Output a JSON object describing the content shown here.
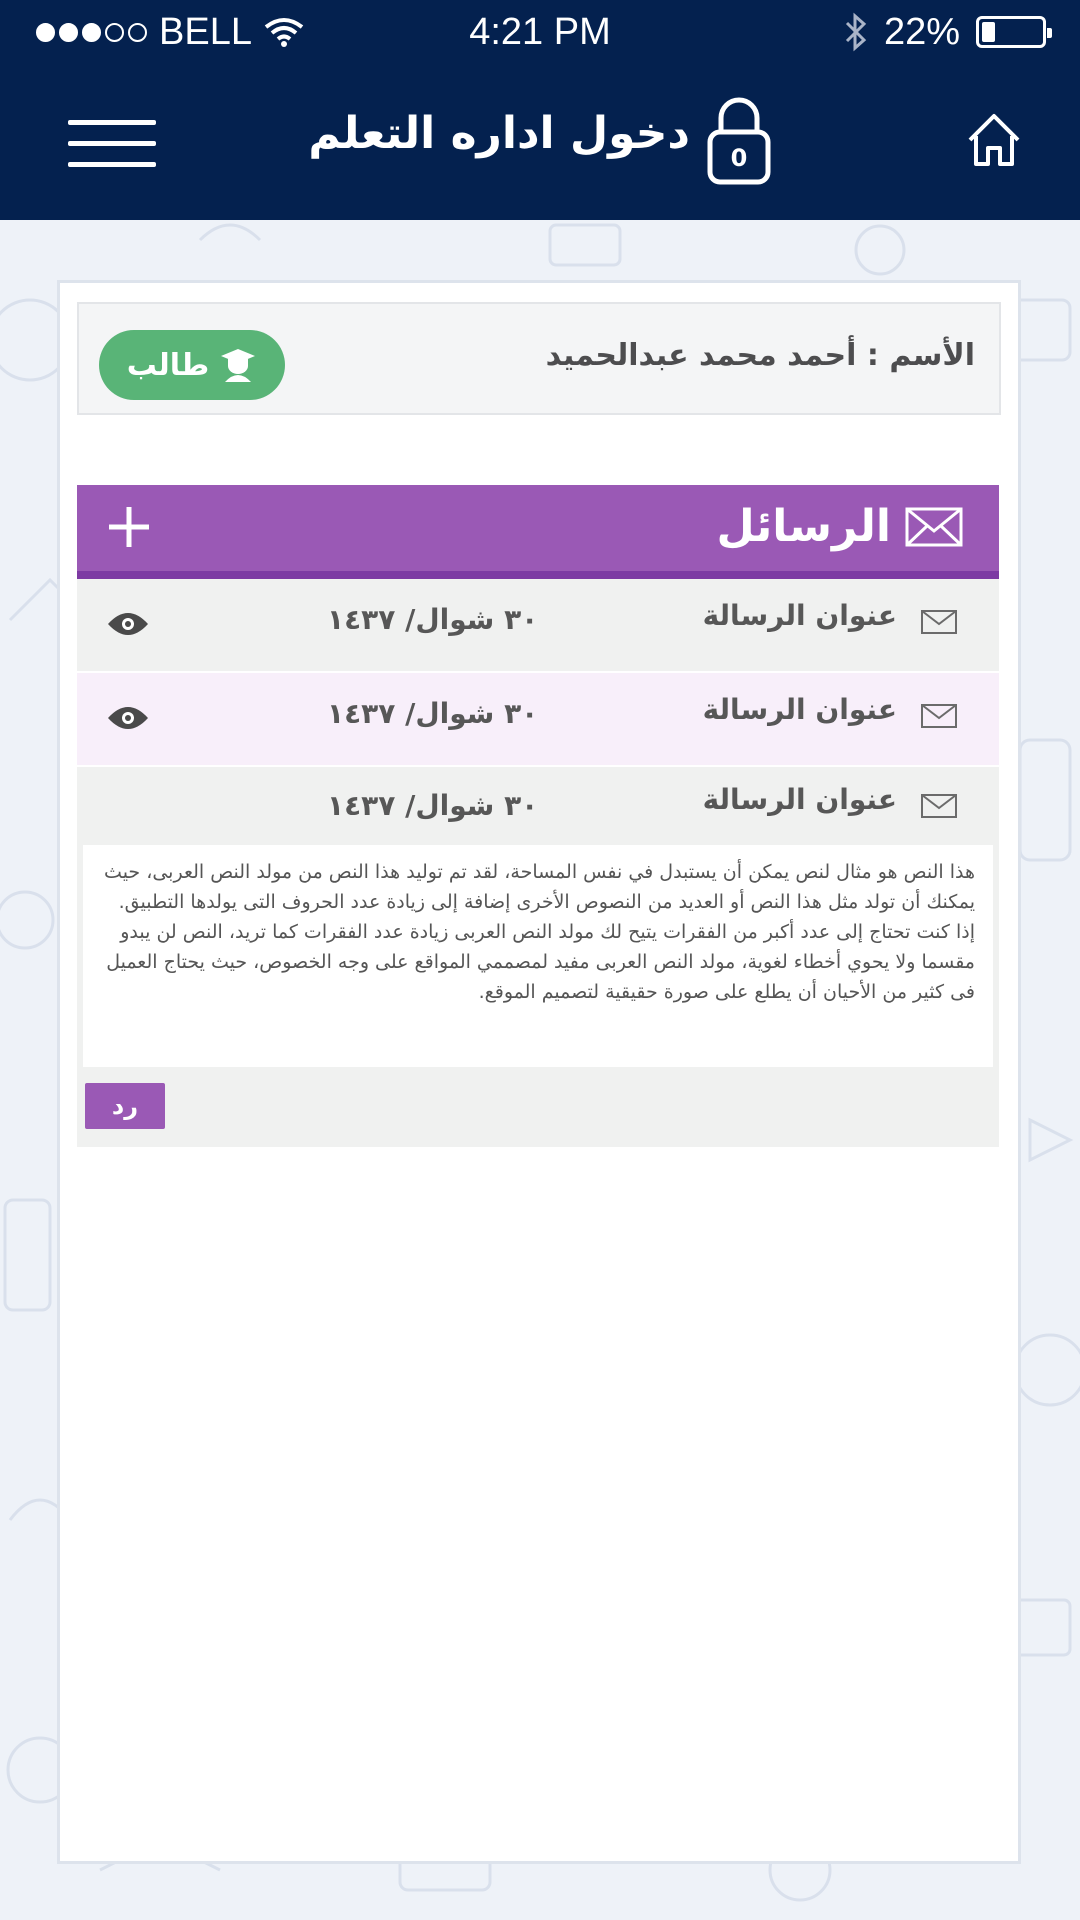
{
  "status_bar": {
    "carrier": "BELL",
    "time": "4:21 PM",
    "battery_percent": "22%",
    "battery_level": 0.22,
    "signal_bars_filled": 3,
    "signal_bars_total": 5
  },
  "header": {
    "title": "دخول اداره التعلم",
    "lock_count": "0",
    "menu_icon": "hamburger-icon",
    "home_icon": "home-icon"
  },
  "user": {
    "name": "الأسم : أحمد محمد عبدالحميد",
    "role": "طالب"
  },
  "messages": {
    "section_title": "الرسائل",
    "items": [
      {
        "subject": "عنوان الرسالة",
        "date": "٣٠ شوال/ ١٤٣٧"
      },
      {
        "subject": "عنوان الرسالة",
        "date": "٣٠ شوال/ ١٤٣٧"
      },
      {
        "subject": "عنوان الرسالة",
        "date": "٣٠ شوال/ ١٤٣٧"
      }
    ],
    "expanded_body": "هذا النص هو مثال لنص يمكن أن يستبدل في نفس المساحة، لقد تم توليد هذا النص من مولد النص العربى، حيث يمكنك أن تولد مثل هذا النص أو العديد من النصوص الأخرى إضافة إلى زيادة عدد الحروف التى يولدها التطبيق. إذا كنت تحتاج إلى عدد أكبر من الفقرات يتيح لك مولد النص العربى زيادة عدد الفقرات كما تريد، النص لن يبدو مقسما ولا يحوي أخطاء لغوية، مولد النص العربى مفيد لمصممي المواقع على وجه الخصوص، حيث يحتاج العميل فى كثير من الأحيان أن يطلع على صورة حقيقية لتصميم الموقع.",
    "reply_label": "رد"
  },
  "colors": {
    "navy": "#04214f",
    "purple": "#9a59b5",
    "green": "#59b477",
    "row_pink": "#f8effa",
    "row_gray": "#f0f1f0"
  }
}
